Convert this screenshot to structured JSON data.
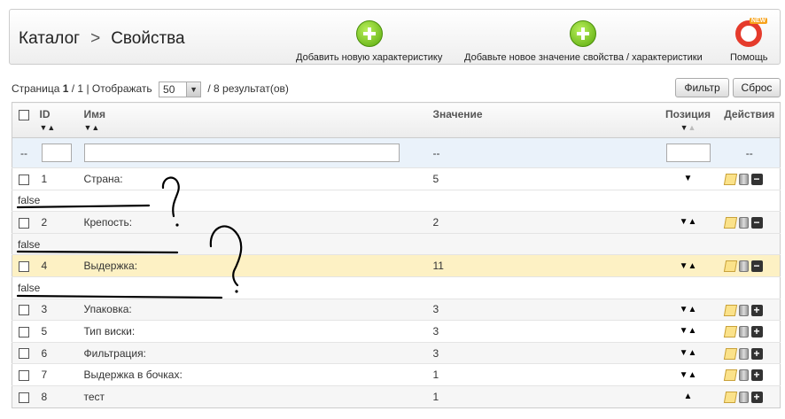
{
  "breadcrumb": {
    "root": "Каталог",
    "separator": ">",
    "current": "Свойства"
  },
  "toolbar": {
    "add_characteristic": "Добавить новую характеристику",
    "add_value": "Добавьте новое значение свойства / характеристики",
    "help": "Помощь",
    "help_badge": "NEW"
  },
  "pager": {
    "page_label": "Страница",
    "page": "1",
    "total_pages": "/ 1",
    "show_label": "| Отображать",
    "per_page": "50",
    "results": "/ 8 результат(ов)"
  },
  "buttons": {
    "filter": "Фильтр",
    "reset": "Сброс"
  },
  "columns": {
    "id": "ID",
    "name": "Имя",
    "value": "Значение",
    "position": "Позиция",
    "actions": "Действия"
  },
  "filter_row": {
    "dash": "--",
    "value_dash": "--",
    "actions_dash": "--"
  },
  "rows": [
    {
      "id": "1",
      "name": "Страна:",
      "value": "5",
      "pos": "▼",
      "action": "−"
    },
    {
      "false": "false"
    },
    {
      "id": "2",
      "name": "Крепость:",
      "value": "2",
      "pos": "▼▲",
      "action": "−"
    },
    {
      "false": "false"
    },
    {
      "id": "4",
      "name": "Выдержка:",
      "value": "11",
      "pos": "▼▲",
      "action": "−"
    },
    {
      "false": "false"
    },
    {
      "id": "3",
      "name": "Упаковка:",
      "value": "3",
      "pos": "▼▲",
      "action": "+"
    },
    {
      "id": "5",
      "name": "Тип виски:",
      "value": "3",
      "pos": "▼▲",
      "action": "+"
    },
    {
      "id": "6",
      "name": "Фильтрация:",
      "value": "3",
      "pos": "▼▲",
      "action": "+"
    },
    {
      "id": "7",
      "name": "Выдержка в бочках:",
      "value": "1",
      "pos": "▼▲",
      "action": "+"
    },
    {
      "id": "8",
      "name": "тест",
      "value": "1",
      "pos": "▲",
      "action": "+"
    }
  ],
  "colors": {
    "highlight_row": "#fdf1c4",
    "filter_row": "#eaf2fa",
    "add_green": "#58a90c",
    "help_red": "#e53b2c"
  }
}
